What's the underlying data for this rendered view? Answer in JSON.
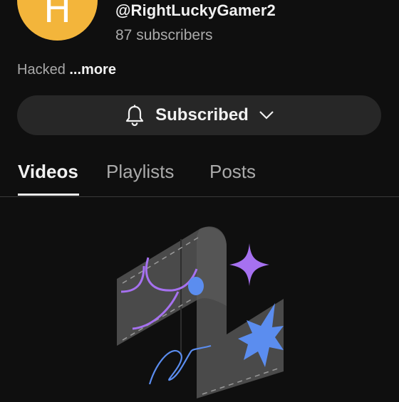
{
  "channel": {
    "avatar_letter": "H",
    "avatar_color": "#f3b53b",
    "handle": "@RightLuckyGamer2",
    "subscribers": "87 subscribers",
    "description": "Hacked",
    "more_label": "...more"
  },
  "subscribe_button": {
    "label": "Subscribed",
    "icon": "bell-icon",
    "dropdown_icon": "chevron-down-icon"
  },
  "tabs": [
    {
      "label": "Videos",
      "active": true
    },
    {
      "label": "Playlists",
      "active": false
    },
    {
      "label": "Posts",
      "active": false
    }
  ],
  "illustration": {
    "icon": "empty-videos-illustration",
    "colors": {
      "panel": "#4a4a4a",
      "purple": "#a671f0",
      "blue": "#5b8def"
    }
  }
}
